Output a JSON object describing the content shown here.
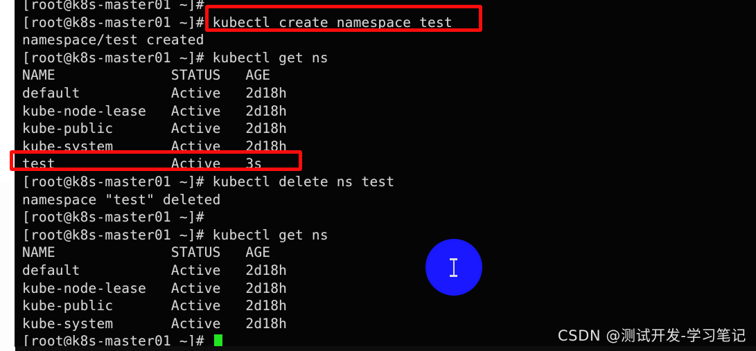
{
  "terminal": {
    "prompt": "[root@k8s-master01 ~]#",
    "lines": [
      {
        "id": "line-1",
        "text": "[root@k8s-master01 ~]#"
      },
      {
        "id": "line-2",
        "text": "[root@k8s-master01 ~]# kubectl create namespace test"
      },
      {
        "id": "line-3",
        "text": "namespace/test created"
      },
      {
        "id": "line-4",
        "text": "[root@k8s-master01 ~]# kubectl get ns"
      },
      {
        "id": "line-5",
        "text": "NAME              STATUS   AGE"
      },
      {
        "id": "line-6",
        "text": "default           Active   2d18h"
      },
      {
        "id": "line-7",
        "text": "kube-node-lease   Active   2d18h"
      },
      {
        "id": "line-8",
        "text": "kube-public       Active   2d18h"
      },
      {
        "id": "line-9",
        "text": "kube-system       Active   2d18h"
      },
      {
        "id": "line-10",
        "text": "test              Active   3s"
      },
      {
        "id": "line-11",
        "text": "[root@k8s-master01 ~]# kubectl delete ns test"
      },
      {
        "id": "line-12",
        "text": "namespace \"test\" deleted"
      },
      {
        "id": "line-13",
        "text": "[root@k8s-master01 ~]#"
      },
      {
        "id": "line-14",
        "text": "[root@k8s-master01 ~]# kubectl get ns"
      },
      {
        "id": "line-15",
        "text": "NAME              STATUS   AGE"
      },
      {
        "id": "line-16",
        "text": "default           Active   2d18h"
      },
      {
        "id": "line-17",
        "text": "kube-node-lease   Active   2d18h"
      },
      {
        "id": "line-18",
        "text": "kube-public       Active   2d18h"
      },
      {
        "id": "line-19",
        "text": "kube-system       Active   2d18h"
      },
      {
        "id": "line-20",
        "text": "[root@k8s-master01 ~]# "
      }
    ],
    "commands": [
      "kubectl create namespace test",
      "kubectl get ns",
      "kubectl delete ns test",
      "kubectl get ns"
    ],
    "outputs": [
      "namespace/test created",
      "namespace \"test\" deleted"
    ],
    "ns_table_first": {
      "headers": [
        "NAME",
        "STATUS",
        "AGE"
      ],
      "rows": [
        [
          "default",
          "Active",
          "2d18h"
        ],
        [
          "kube-node-lease",
          "Active",
          "2d18h"
        ],
        [
          "kube-public",
          "Active",
          "2d18h"
        ],
        [
          "kube-system",
          "Active",
          "2d18h"
        ],
        [
          "test",
          "Active",
          "3s"
        ]
      ]
    },
    "ns_table_second": {
      "headers": [
        "NAME",
        "STATUS",
        "AGE"
      ],
      "rows": [
        [
          "default",
          "Active",
          "2d18h"
        ],
        [
          "kube-node-lease",
          "Active",
          "2d18h"
        ],
        [
          "kube-public",
          "Active",
          "2d18h"
        ],
        [
          "kube-system",
          "Active",
          "2d18h"
        ]
      ]
    },
    "colors": {
      "background": "#050505",
      "text": "#d6d6d6",
      "cursor": "#22e522"
    }
  },
  "annotations": {
    "highlight_color": "#fb0d0d",
    "boxes": [
      {
        "id": "redbox-create-ns",
        "target_text": "kubectl create namespace test"
      },
      {
        "id": "redbox-test-row",
        "target_text": "test              Active   3s"
      }
    ]
  },
  "cursor": {
    "type": "i-beam",
    "highlight_color": "#1a18ff"
  },
  "watermark": {
    "text": "CSDN @测试开发-学习笔记"
  }
}
